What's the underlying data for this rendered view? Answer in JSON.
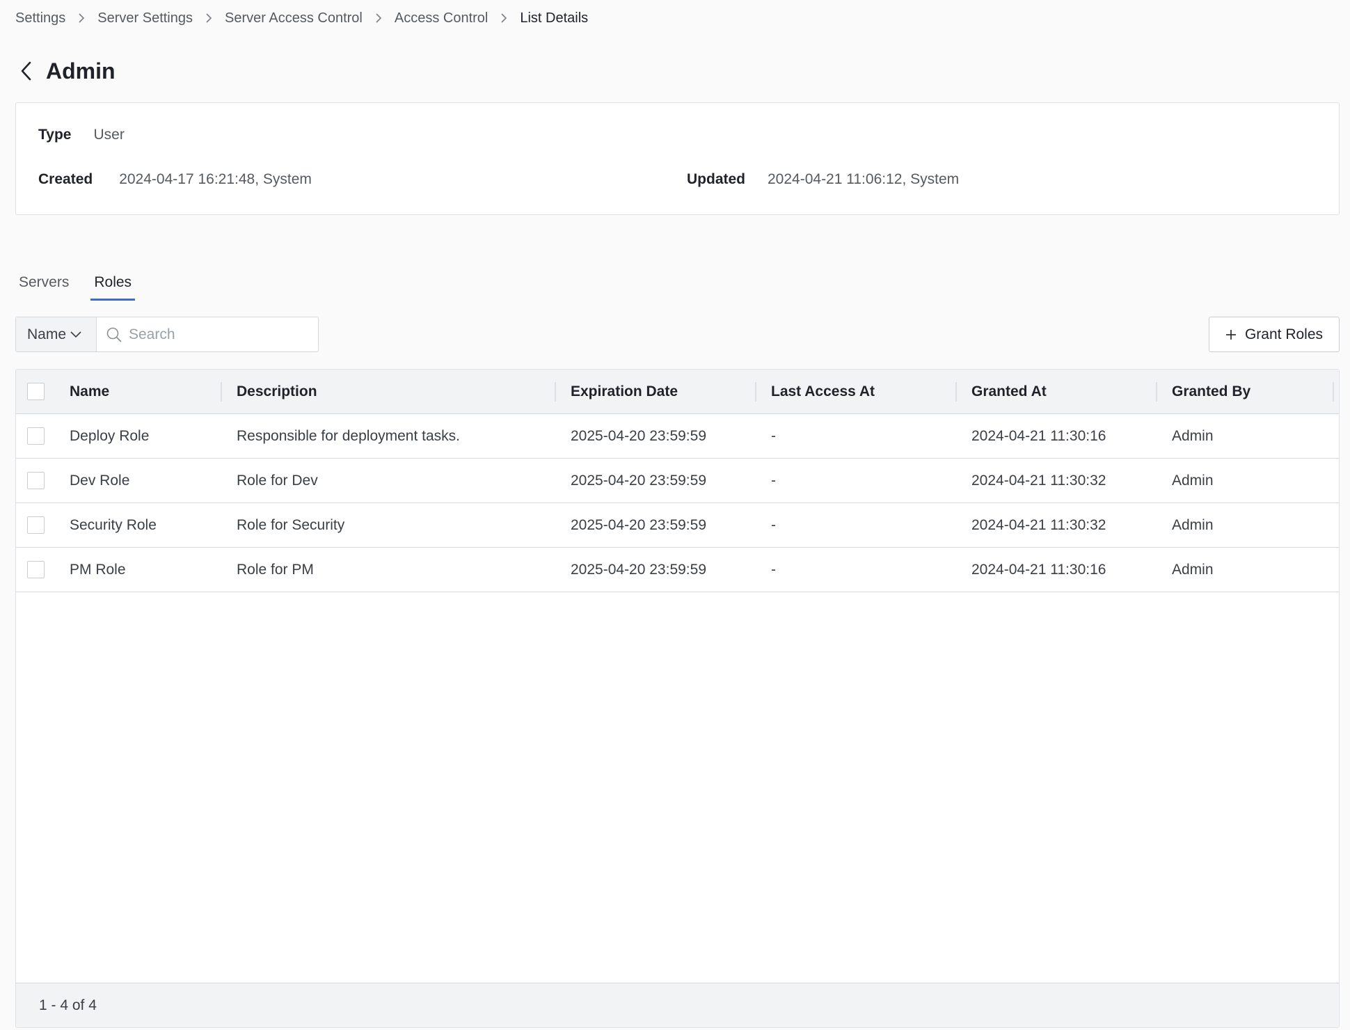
{
  "breadcrumb": {
    "items": [
      "Settings",
      "Server Settings",
      "Server Access Control",
      "Access Control"
    ],
    "current": "List Details"
  },
  "header": {
    "title": "Admin"
  },
  "info": {
    "type_label": "Type",
    "type_value": "User",
    "created_label": "Created",
    "created_value": "2024-04-17 16:21:48, System",
    "updated_label": "Updated",
    "updated_value": "2024-04-21 11:06:12, System"
  },
  "tabs": [
    {
      "label": "Servers",
      "active": false
    },
    {
      "label": "Roles",
      "active": true
    }
  ],
  "filter": {
    "field": "Name",
    "search_placeholder": "Search"
  },
  "actions": {
    "grant_roles_label": "Grant Roles"
  },
  "table": {
    "columns": [
      "Name",
      "Description",
      "Expiration Date",
      "Last Access At",
      "Granted At",
      "Granted By"
    ],
    "rows": [
      [
        "Deploy Role",
        "Responsible for deployment tasks.",
        "2025-04-20 23:59:59",
        "-",
        "2024-04-21 11:30:16",
        "Admin"
      ],
      [
        "Dev Role",
        "Role for Dev",
        "2025-04-20 23:59:59",
        "-",
        "2024-04-21 11:30:32",
        "Admin"
      ],
      [
        "Security Role",
        "Role for Security",
        "2025-04-20 23:59:59",
        "-",
        "2024-04-21 11:30:32",
        "Admin"
      ],
      [
        "PM Role",
        "Role for PM",
        "2025-04-20 23:59:59",
        "-",
        "2024-04-21 11:30:16",
        "Admin"
      ]
    ]
  },
  "pagination": {
    "summary": "1 - 4 of 4"
  },
  "colors": {
    "accent": "#2f6fde",
    "header_bg": "#f2f3f5",
    "page_bg": "#fafafa"
  }
}
